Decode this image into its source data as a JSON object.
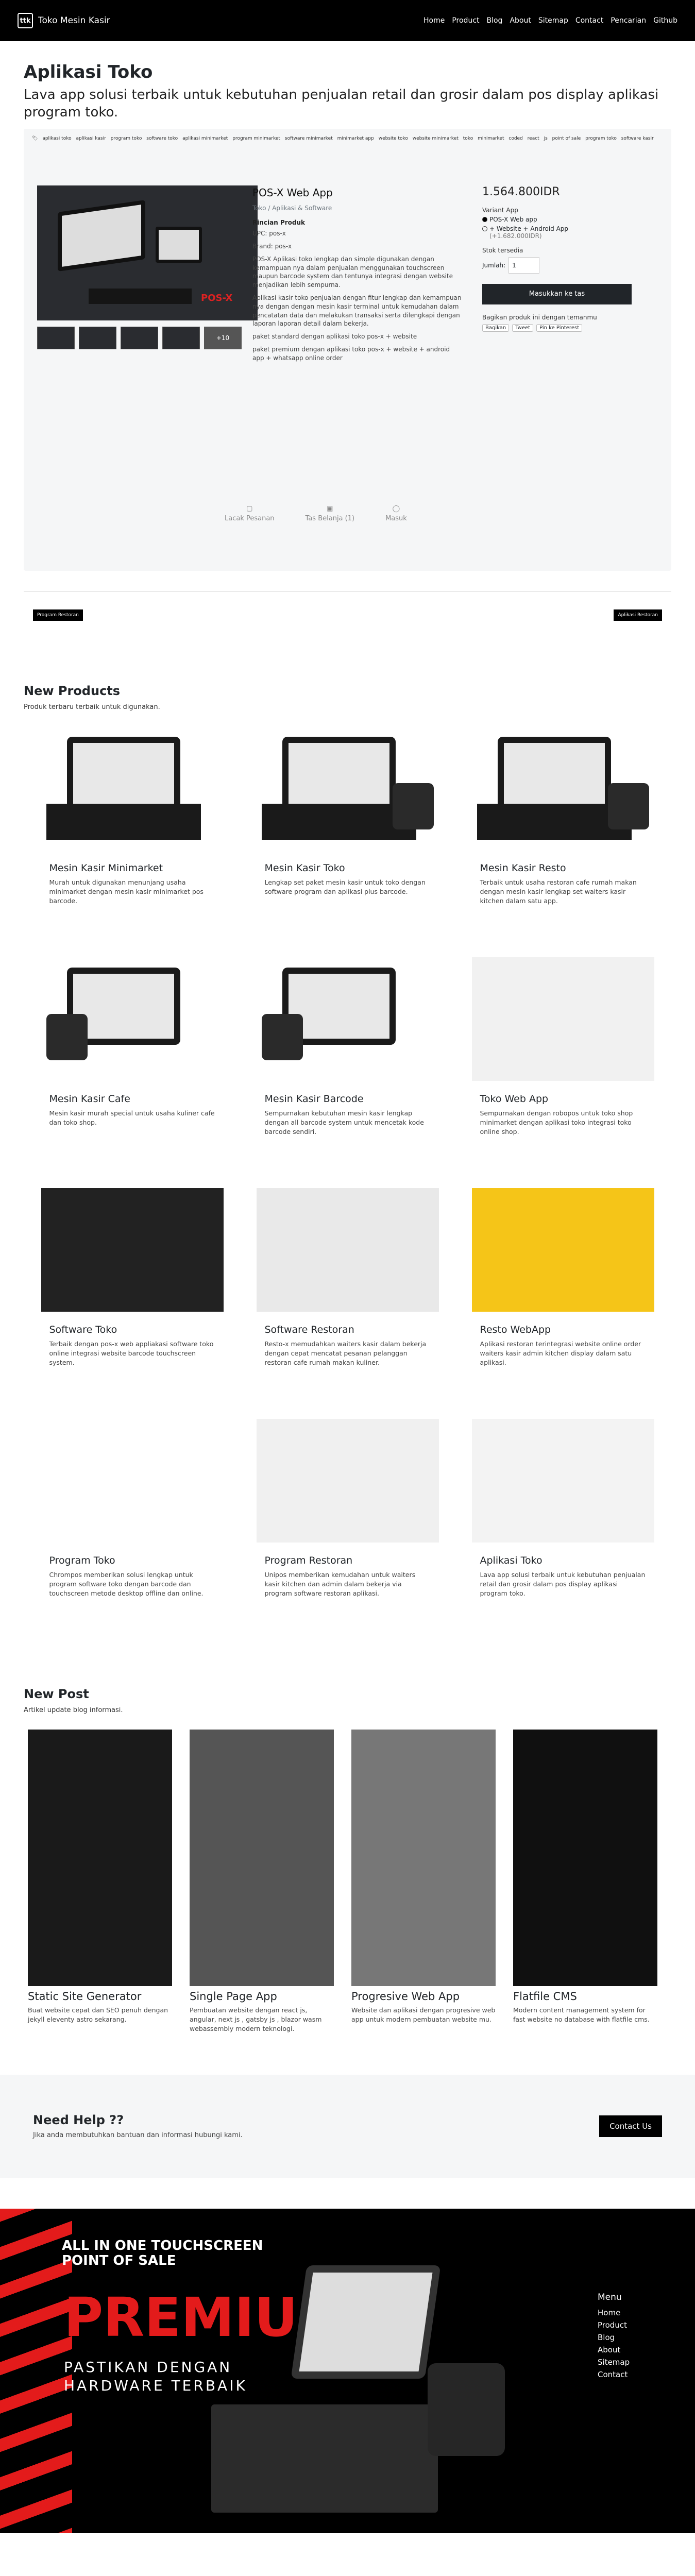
{
  "nav": {
    "brand": "Toko Mesin Kasir",
    "logo": "ttk",
    "links": [
      "Home",
      "Product",
      "Blog",
      "About",
      "Sitemap",
      "Contact",
      "Pencarian",
      "Github"
    ]
  },
  "hero": {
    "title": "Aplikasi Toko",
    "subtitle": "Lava app solusi terbaik untuk kebutuhan penjualan retail dan grosir dalam pos display aplikasi program toko."
  },
  "tags": [
    "aplikasi toko",
    "aplikasi kasir",
    "program toko",
    "software toko",
    "aplikasi minimarket",
    "program minimarket",
    "software minimarket",
    "minimarket app",
    "website toko",
    "website minimarket",
    "toko",
    "minimarket",
    "coded",
    "react",
    "js",
    "point of sale",
    "program toko",
    "software kasir"
  ],
  "product": {
    "name": "POS-X Web App",
    "crumb": [
      "Toko",
      "Aplikasi & Software"
    ],
    "detail_title": "Rincian Produk",
    "upc": "UPC: pos-x",
    "brand": "Brand: pos-x",
    "desc": [
      "POS-X Aplikasi toko lengkap dan simple digunakan dengan kemampuan nya dalam penjualan menggunakan touchscreen maupun barcode system dan tentunya integrasi dengan website menjadikan lebih sempurna.",
      "Aplikasi kasir toko penjualan dengan fitur lengkap dan kemampuan nya dengan dengan mesin kasir terminal untuk kemudahan dalam pencatatan data dan melakukan transaksi serta dilengkapi dengan laporan laporan detail dalam bekerja.",
      "paket standard dengan aplikasi toko pos-x + website",
      "paket premium dengan aplikasi toko pos-x + website + android app + whatsapp online order"
    ],
    "more_thumbs": "+10",
    "logo_text": "POS-X",
    "price": "1.564.800IDR",
    "variant_label": "Variant App",
    "variants": [
      "POS-X Web app",
      "+ Website + Android App"
    ],
    "variant_extra": "(+1.682.000IDR)",
    "stock": "Stok tersedia",
    "qty_label": "Jumlah:",
    "qty": "1",
    "cart": "Masukkan ke tas",
    "share_label": "Bagikan produk ini dengan temanmu",
    "share": [
      "Bagikan",
      "Tweet",
      "Pin ke Pinterest"
    ],
    "footer_links": [
      "Lacak Pesanan",
      "Tas Belanja (1)",
      "Masuk"
    ]
  },
  "pills": {
    "left": "Program Restoran",
    "right": "Aplikasi Restoran"
  },
  "new_products": {
    "title": "New Products",
    "desc": "Produk terbaru terbaik untuk digunakan.",
    "items": [
      {
        "title": "Mesin Kasir Minimarket",
        "desc": "Murah untuk digunakan menunjang usaha minimarket dengan mesin kasir minimarket pos barcode."
      },
      {
        "title": "Mesin Kasir Toko",
        "desc": "Lengkap set paket mesin kasir untuk toko dengan software program dan aplikasi plus barcode."
      },
      {
        "title": "Mesin Kasir Resto",
        "desc": "Terbaik untuk usaha restoran cafe rumah makan dengan mesin kasir lengkap set waiters kasir kitchen dalam satu app."
      },
      {
        "title": "Mesin Kasir Cafe",
        "desc": "Mesin kasir murah special untuk usaha kuliner cafe dan toko shop."
      },
      {
        "title": "Mesin Kasir Barcode",
        "desc": "Sempurnakan kebutuhan mesin kasir lengkap dengan all barcode system untuk mencetak kode barcode sendiri."
      },
      {
        "title": "Toko Web App",
        "desc": "Sempurnakan dengan robopos untuk toko shop minimarket dengan aplikasi toko integrasi toko online shop."
      },
      {
        "title": "Software Toko",
        "desc": "Terbaik dengan pos-x web appliakasi software toko online integrasi website barcode touchscreen system."
      },
      {
        "title": "Software Restoran",
        "desc": "Resto-x memudahkan waiters kasir dalam bekerja dengan cepat mencatat pesanan pelanggan restoran cafe rumah makan kuliner."
      },
      {
        "title": "Resto WebApp",
        "desc": "Aplikasi restoran terintegrasi website online order waiters kasir admin kitchen display dalam satu aplikasi."
      },
      {
        "title": "Program Toko",
        "desc": "Chrompos memberikan solusi lengkap untuk program software toko dengan barcode dan touchscreen metode desktop offline dan online."
      },
      {
        "title": "Program Restoran",
        "desc": "Unipos memberikan kemudahan untuk waiters kasir kitchen dan admin dalam bekerja via program software restoran aplikasi."
      },
      {
        "title": "Aplikasi Toko",
        "desc": "Lava app solusi terbaik untuk kebutuhan penjualan retail dan grosir dalam pos display aplikasi program toko."
      }
    ]
  },
  "new_post": {
    "title": "New Post",
    "desc": "Artikel update blog informasi.",
    "items": [
      {
        "title": "Static Site Generator",
        "desc": "Buat website cepat dan SEO penuh dengan jekyll eleventy astro sekarang."
      },
      {
        "title": "Single Page App",
        "desc": "Pembuatan website dengan react js, angular, next js , gatsby js , blazor wasm webassembly modern teknologi."
      },
      {
        "title": "Progresive Web App",
        "desc": "Website dan aplikasi dengan progresive web app untuk modern pembuatan website mu."
      },
      {
        "title": "Flatfile CMS",
        "desc": "Modern content management system for fast website no database with flatfile cms."
      }
    ]
  },
  "help": {
    "title": "Need Help ??",
    "desc": "Jika anda membutuhkan bantuan dan informasi hubungi kami.",
    "button": "Contact Us"
  },
  "footer": {
    "line1": "ALL IN ONE TOUCHSCREEN POINT OF SALE",
    "line2": "PREMIUM",
    "line3": "PASTIKAN DENGAN HARDWARE TERBAIK",
    "menu_title": "Menu",
    "menu": [
      "Home",
      "Product",
      "Blog",
      "About",
      "Sitemap",
      "Contact"
    ]
  }
}
